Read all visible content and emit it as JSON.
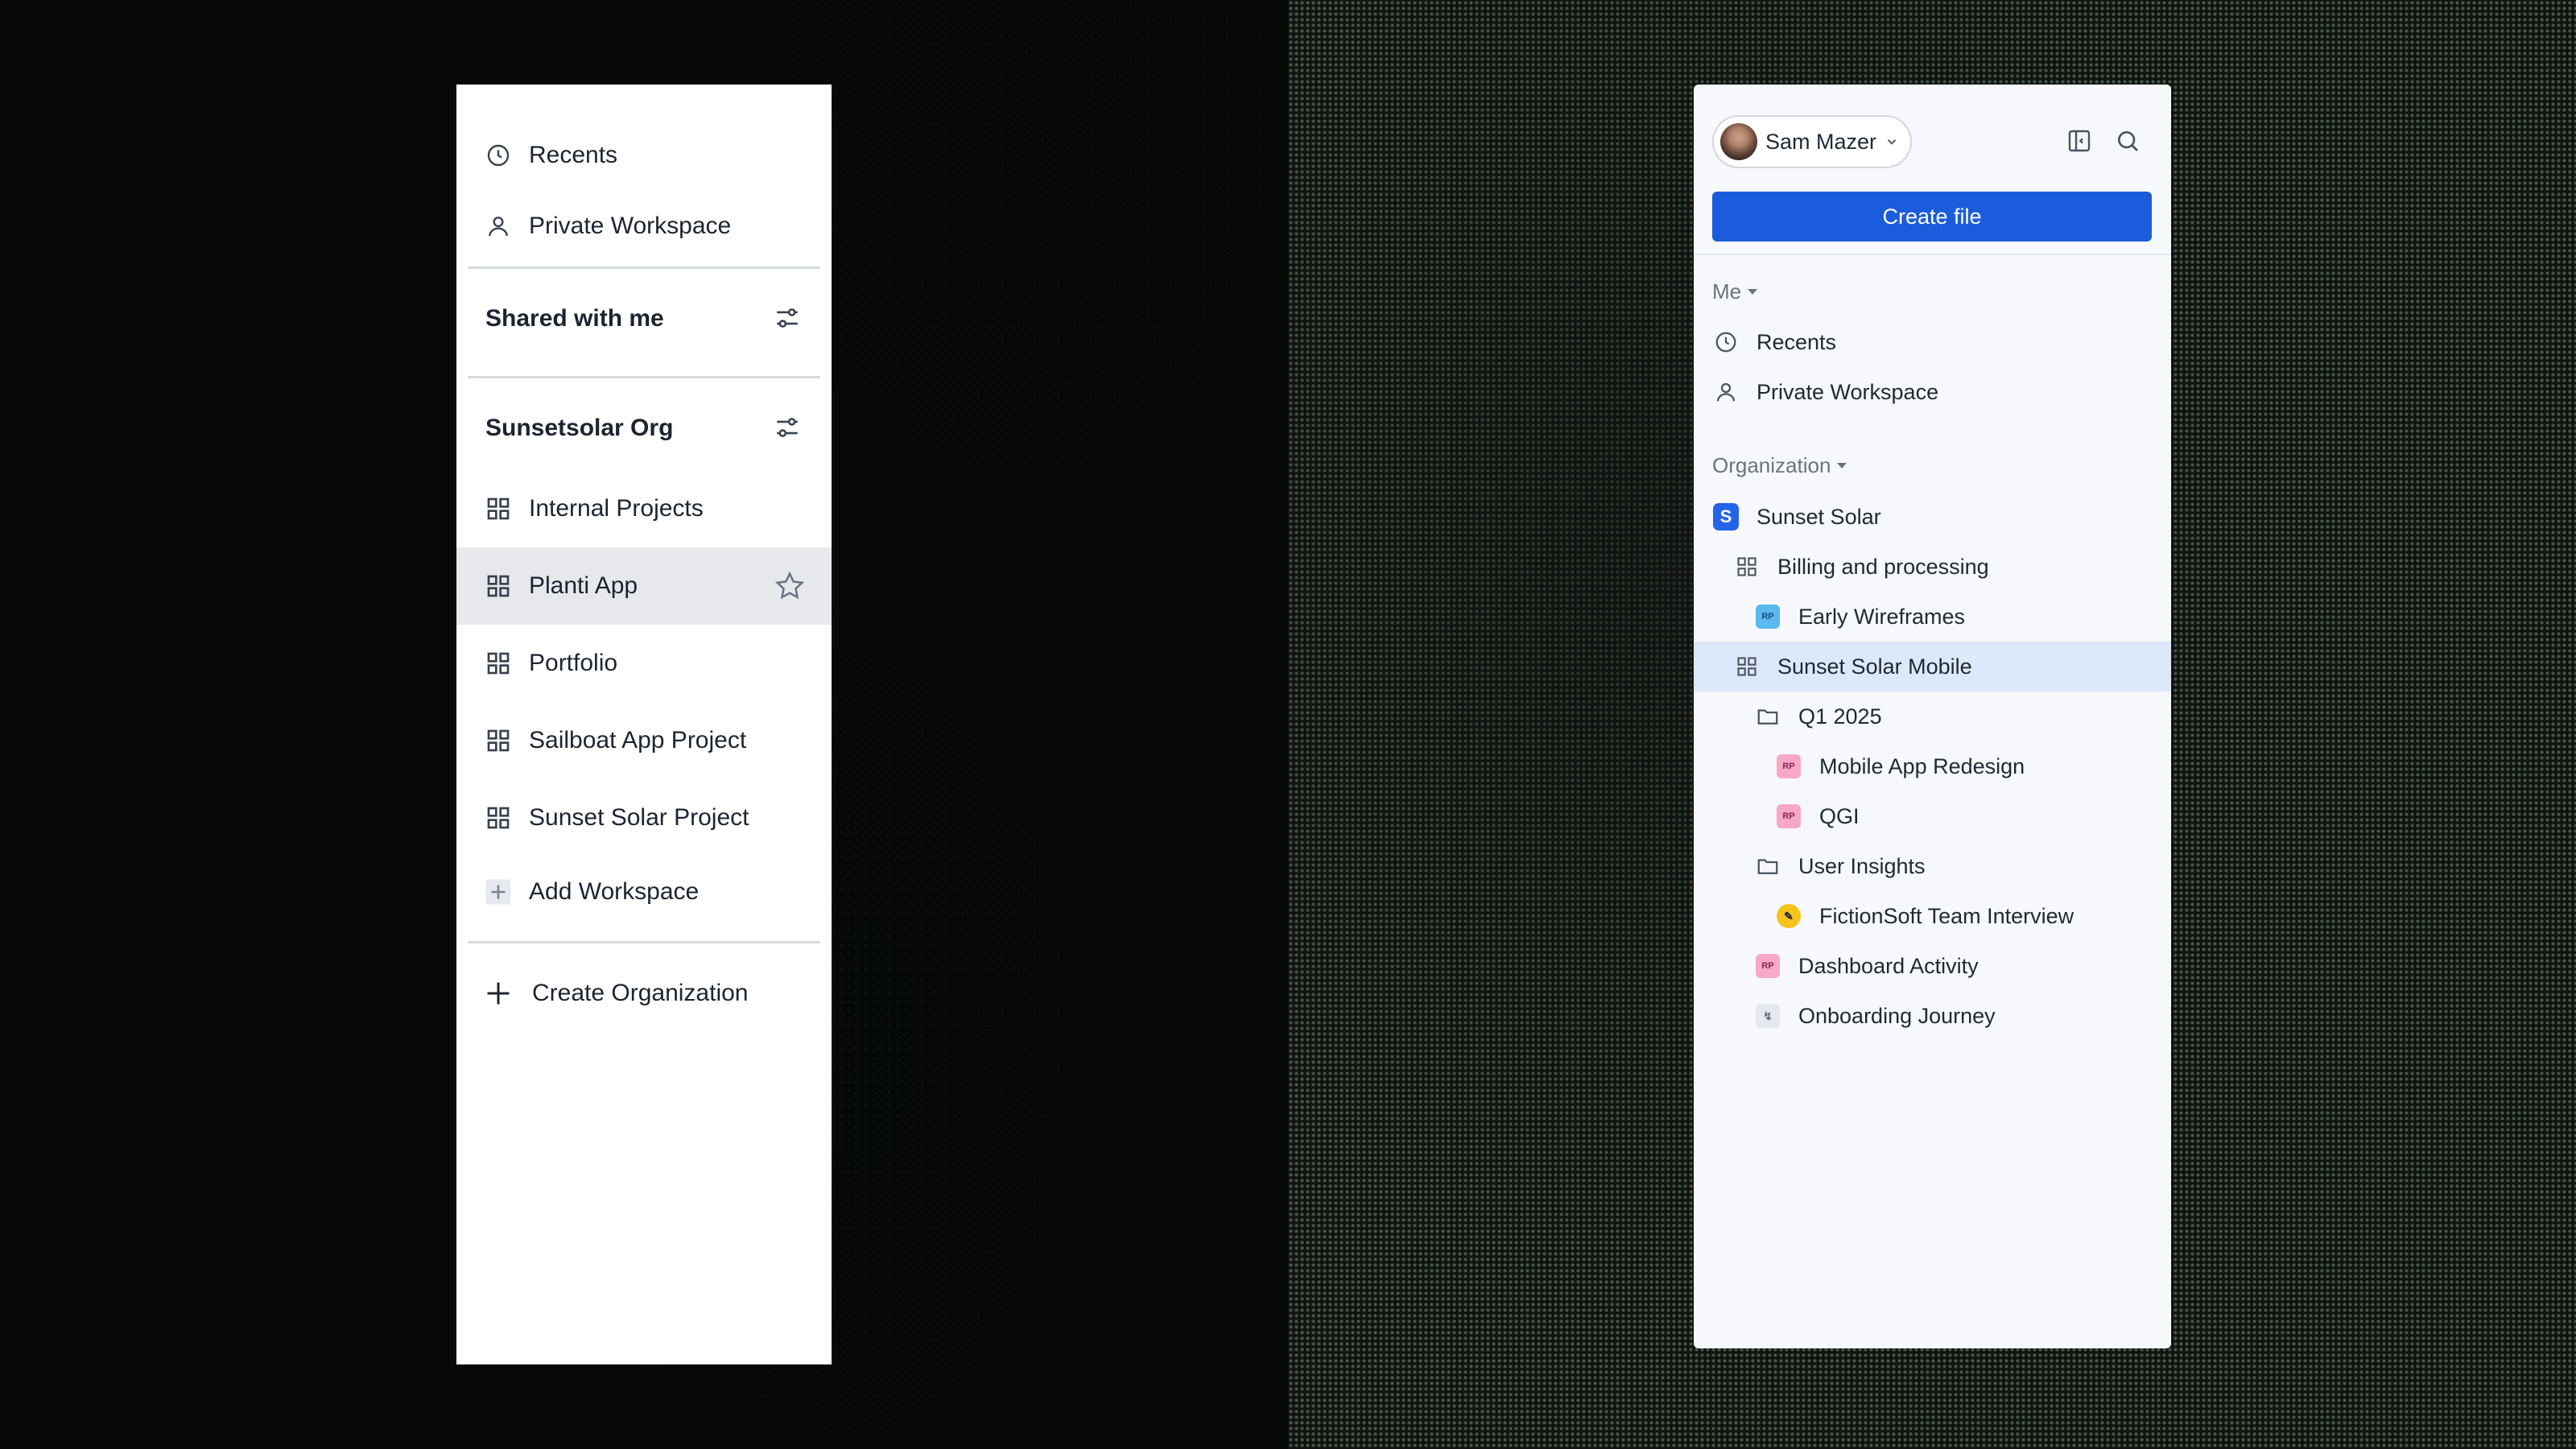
{
  "left_panel": {
    "top_items": [
      {
        "label": "Recents",
        "icon": "clock-icon"
      },
      {
        "label": "Private Workspace",
        "icon": "user-icon"
      }
    ],
    "shared_header": "Shared with me",
    "org_header": "Sunsetsolar Org",
    "workspaces": [
      {
        "label": "Internal Projects",
        "icon": "grid-icon"
      },
      {
        "label": "Planti App",
        "icon": "grid-icon",
        "active": true
      },
      {
        "label": "Portfolio",
        "icon": "grid-icon"
      },
      {
        "label": "Sailboat App Project",
        "icon": "grid-icon"
      },
      {
        "label": "Sunset Solar Project",
        "icon": "grid-icon"
      }
    ],
    "add_workspace": "Add Workspace",
    "create_org": "Create Organization"
  },
  "right_panel": {
    "user_name": "Sam Mazer",
    "create_button": "Create file",
    "me_section": "Me",
    "me_items": [
      {
        "label": "Recents",
        "icon": "clock-icon"
      },
      {
        "label": "Private Workspace",
        "icon": "user-icon"
      }
    ],
    "org_section": "Organization",
    "tree": [
      {
        "label": "Sunset Solar",
        "badge": "S"
      },
      {
        "label": "Billing and processing"
      },
      {
        "label": "Early Wireframes",
        "badge": "RP"
      },
      {
        "label": "Sunset Solar Mobile",
        "selected": true
      },
      {
        "label": "Q1 2025"
      },
      {
        "label": "Mobile App Redesign",
        "badge": "RP"
      },
      {
        "label": "QGI",
        "badge": "RP"
      },
      {
        "label": "User Insights"
      },
      {
        "label": "FictionSoft Team Interview"
      },
      {
        "label": "Dashboard Activity",
        "badge": "RP"
      },
      {
        "label": "Onboarding Journey"
      }
    ],
    "accent_color": "#1a5cdb",
    "selected_color": "#dde8fa"
  }
}
